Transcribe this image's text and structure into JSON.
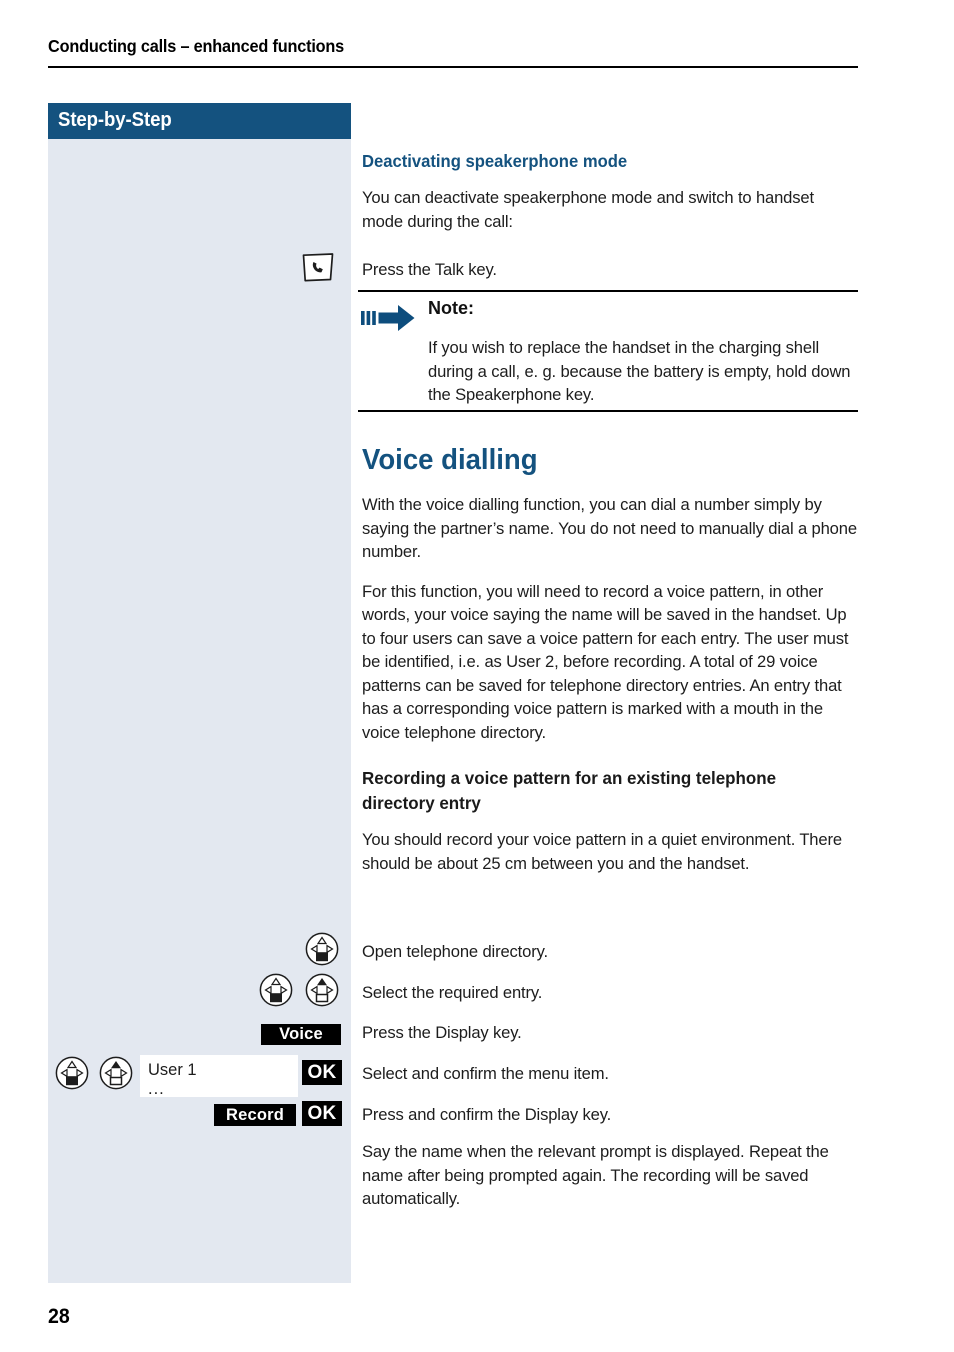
{
  "page": {
    "running_header": "Conducting calls – enhanced functions",
    "folio": "28"
  },
  "sidebar": {
    "title": "Step-by-Step"
  },
  "colors": {
    "brand_blue": "#14527f",
    "sidebar_bg": "#e3e8f0",
    "badge_bg": "#000000",
    "body_text": "#1d1d1d"
  },
  "sections": {
    "deactivating": {
      "heading": "Deactivating speakerphone mode",
      "intro": "You can deactivate speakerphone mode and switch to handset mode during the call:",
      "step_talk": "Press the Talk key.",
      "talk_icon": "talk-key-icon"
    },
    "note": {
      "icon": "note-arrow-icon",
      "title": "Note:",
      "body": "If you wish to replace the handset in the charging shell during a call, e. g. because the battery is empty, hold down the Speakerphone key."
    },
    "voice_dialling": {
      "heading": "Voice dialling",
      "para1": "With the voice dialling function, you can dial a number simply by saying the partner’s name. You do not need to manually dial a phone number.",
      "para2": "For this function, you will need to record a voice pattern, in other words, your voice saying the name will be saved in the handset. Up to four users can save a voice pattern for each entry. The user must be identified, i.e. as User 2, before recording. A total of 29 voice patterns can be saved for telephone directory entries. An entry that has a corresponding voice pattern is marked with a mouth in the voice telephone directory.",
      "subheading": "Recording a voice pattern for an existing telephone directory entry",
      "para3": "You should record your voice pattern in a quiet environment. There should be about 25 cm between you and the handset."
    }
  },
  "steps": [
    {
      "icons": [
        "nav-key-down-icon"
      ],
      "text": "Open telephone directory."
    },
    {
      "icons": [
        "nav-key-down-icon",
        "nav-key-up-icon"
      ],
      "text": "Select the required entry."
    },
    {
      "icons": [
        "display-key-voice"
      ],
      "text": "Press the Display key."
    },
    {
      "icons": [
        "nav-key-down-icon",
        "nav-key-up-icon",
        "display-entry-user",
        "display-key-ok"
      ],
      "text": "Select and confirm the menu item."
    },
    {
      "icons": [
        "display-key-record",
        "display-key-ok"
      ],
      "text": "Press and confirm the Display key."
    },
    {
      "icons": [],
      "text": "Say the name when the relevant prompt is displayed. Repeat the name after being prompted again. The recording will be saved automatically."
    }
  ],
  "display_keys": {
    "voice": "Voice",
    "record": "Record",
    "ok": "OK"
  },
  "display_entry": {
    "line1": "User 1",
    "line2": "..."
  }
}
